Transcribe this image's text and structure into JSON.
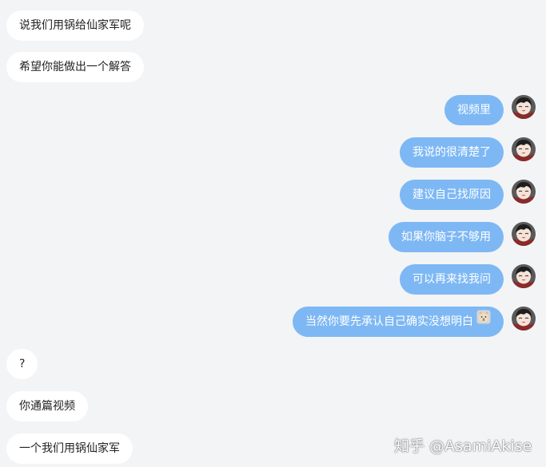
{
  "messages": [
    {
      "side": "in",
      "text": "说我们用锅给仙家军呢"
    },
    {
      "side": "in",
      "text": "希望你能做出一个解答"
    },
    {
      "side": "out",
      "text": "视频里"
    },
    {
      "side": "out",
      "text": "我说的很清楚了"
    },
    {
      "side": "out",
      "text": "建议自己找原因"
    },
    {
      "side": "out",
      "text": "如果你脑子不够用"
    },
    {
      "side": "out",
      "text": "可以再来找我问"
    },
    {
      "side": "out",
      "text": "当然你要先承认自己确实没想明白",
      "emoji": "dog-face-emoji"
    },
    {
      "side": "in",
      "text": "?"
    },
    {
      "side": "in",
      "text": "你通篇视频"
    },
    {
      "side": "in",
      "text": "一个我们用锅仙家军"
    }
  ],
  "watermark": "知乎 @AsamiAkise",
  "colors": {
    "background": "#f3f4f6",
    "incoming_bubble": "#ffffff",
    "outgoing_bubble": "#7eb8f4",
    "incoming_text": "#222222",
    "outgoing_text": "#ffffff"
  }
}
